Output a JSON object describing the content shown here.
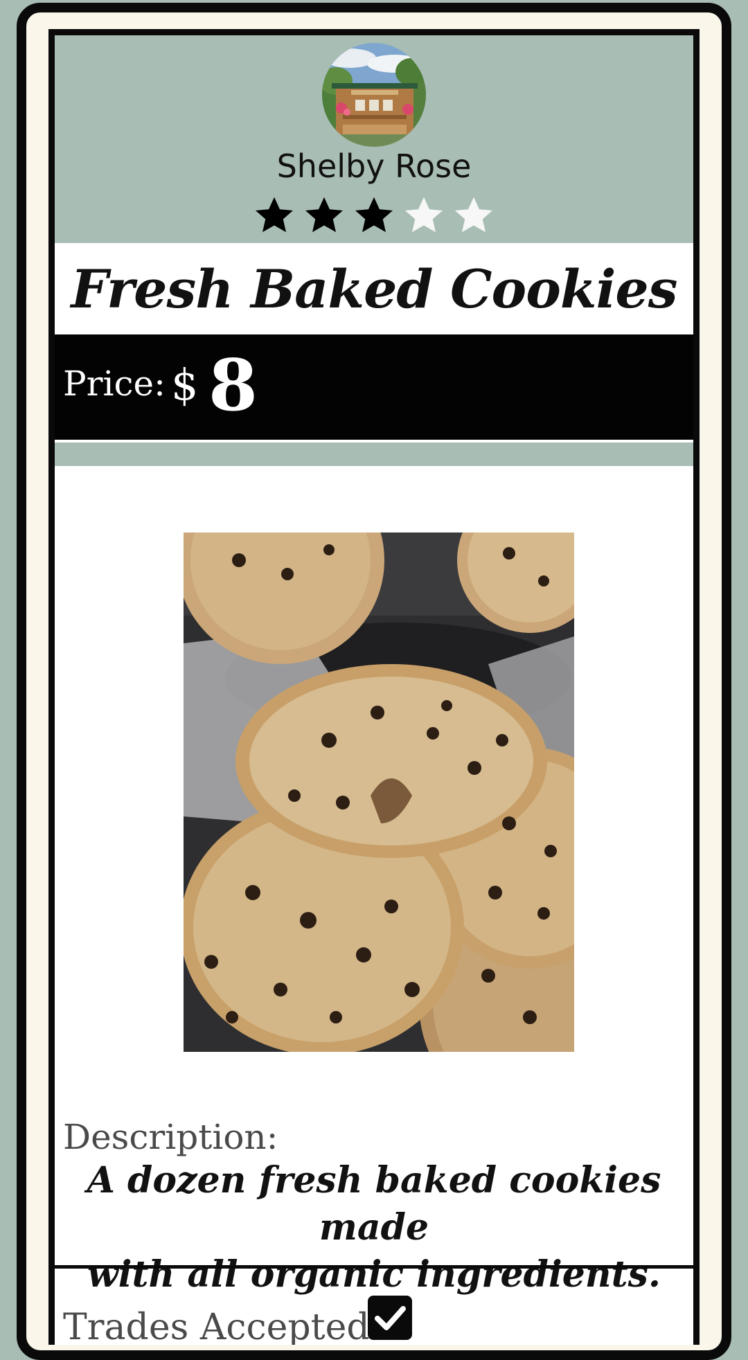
{
  "seller": {
    "name": "Shelby Rose",
    "rating": 3,
    "max_rating": 5,
    "avatar_icon": "market-stand-photo"
  },
  "listing": {
    "title": "Fresh Baked Cookies",
    "price_label": "Price:",
    "currency": "$",
    "price": "8",
    "photo_icon": "chocolate-chip-cookies-photo",
    "description_label": "Description:",
    "description_line1": "A dozen fresh baked cookies made",
    "description_line2": "with all organic ingredients.",
    "trades_label": "Trades Accepted?",
    "trades_accepted": true
  },
  "colors": {
    "sage": "#a8bdb3",
    "frame": "#0a0a0a",
    "star_filled": "#000000",
    "star_empty": "#f7f7f7"
  }
}
